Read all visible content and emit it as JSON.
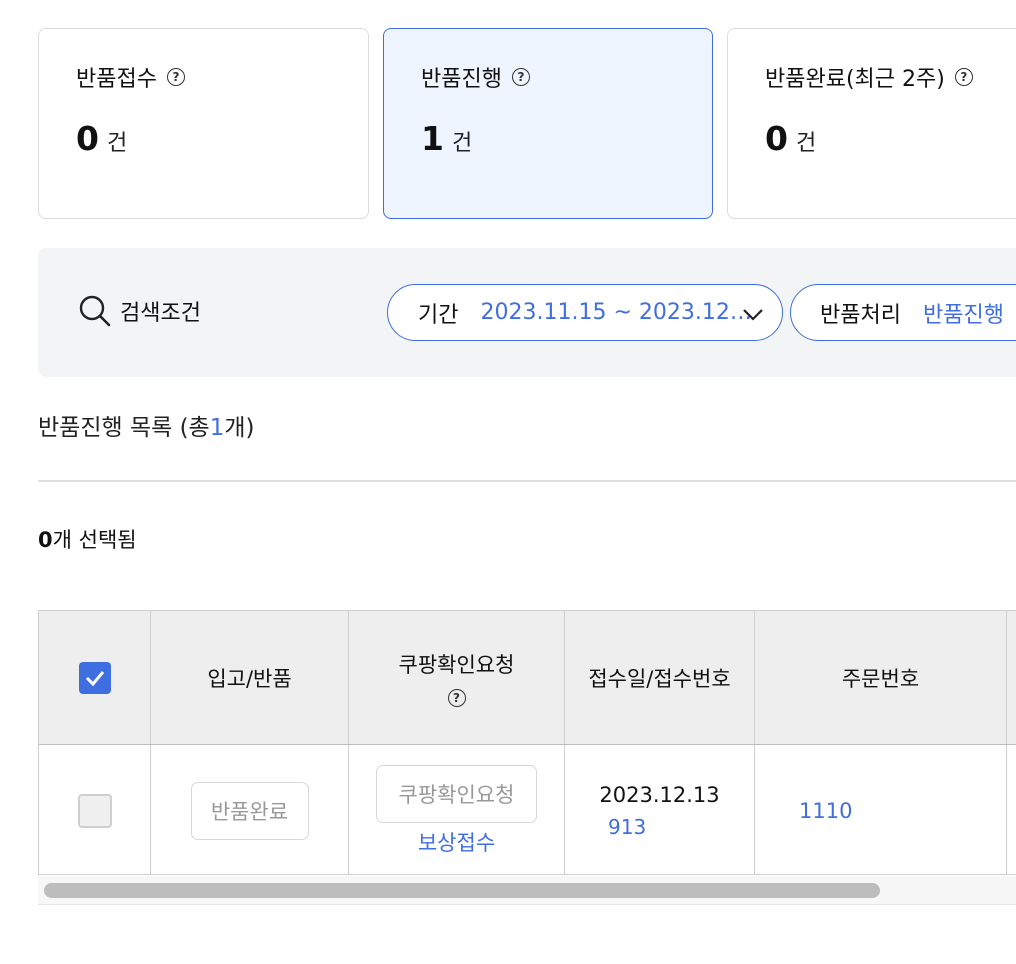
{
  "summary": [
    {
      "title": "반품접수",
      "count": "0",
      "unit": "건"
    },
    {
      "title": "반품진행",
      "count": "1",
      "unit": "건"
    },
    {
      "title": "반품완료(최근 2주)",
      "count": "0",
      "unit": "건"
    }
  ],
  "help_glyph": "?",
  "search": {
    "label": "검색조건",
    "period_label": "기간",
    "period_value": "2023.11.15 ~ 2023.12…",
    "status_label": "반품처리",
    "status_value": "반품진행"
  },
  "list": {
    "title_prefix": "반품진행 목록 (총",
    "total": "1",
    "title_suffix": "개)",
    "selected_num": "0",
    "selected_text": "개 선택됨"
  },
  "table": {
    "headers": [
      "입고/반품",
      "쿠팡확인요청",
      "접수일/접수번호",
      "주문번호"
    ],
    "rows": [
      {
        "status_button": "반품완료",
        "confirm_button": "쿠팡확인요청",
        "compensation_link": "보상접수",
        "date": "2023.12.13",
        "receipt_no": "913",
        "order_no": "1110"
      }
    ]
  },
  "colors": {
    "accent": "#3f6ee0",
    "active_card_bg": "#eff5ff",
    "header_bg": "#eeeeee"
  }
}
